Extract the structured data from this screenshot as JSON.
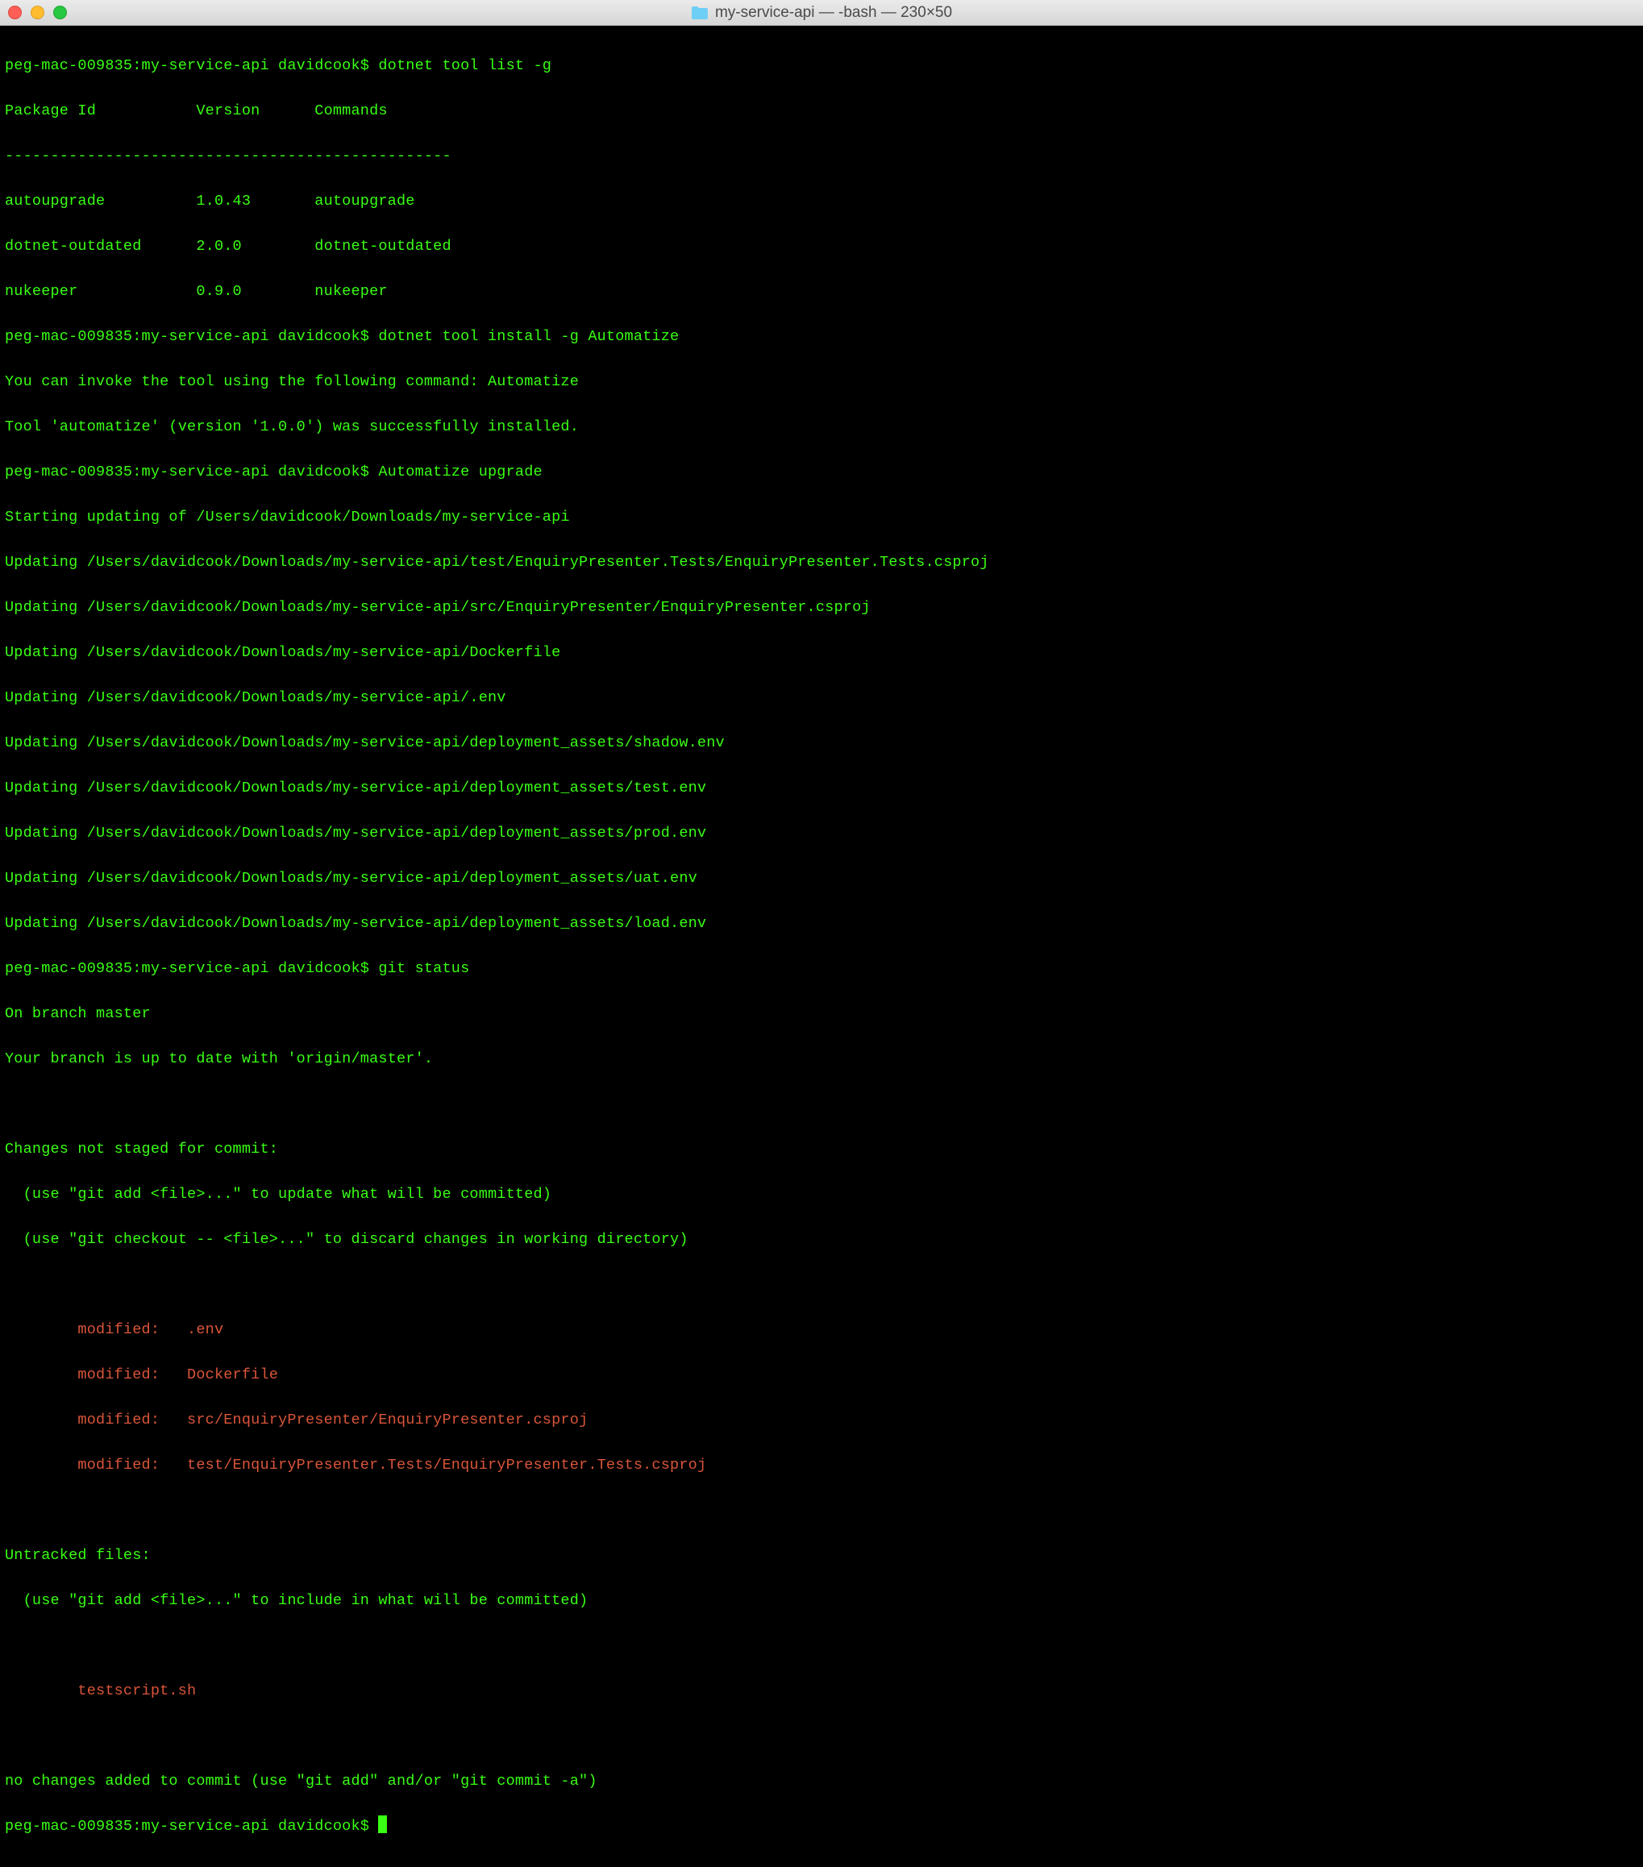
{
  "titlebar": {
    "title": "my-service-api — -bash — 230×50"
  },
  "prompt": "peg-mac-009835:my-service-api davidcook$ ",
  "commands": {
    "c1": "dotnet tool list -g",
    "c2": "dotnet tool install -g Automatize",
    "c3": "Automatize upgrade",
    "c4": "git status"
  },
  "toollist": {
    "header": "Package Id           Version      Commands",
    "divider": "-------------------------------------------------",
    "rows": [
      "autoupgrade          1.0.43       autoupgrade",
      "dotnet-outdated      2.0.0        dotnet-outdated",
      "nukeeper             0.9.0        nukeeper"
    ]
  },
  "install": {
    "l1": "You can invoke the tool using the following command: Automatize",
    "l2": "Tool 'automatize' (version '1.0.0') was successfully installed."
  },
  "upgrade": [
    "Starting updating of /Users/davidcook/Downloads/my-service-api",
    "Updating /Users/davidcook/Downloads/my-service-api/test/EnquiryPresenter.Tests/EnquiryPresenter.Tests.csproj",
    "Updating /Users/davidcook/Downloads/my-service-api/src/EnquiryPresenter/EnquiryPresenter.csproj",
    "Updating /Users/davidcook/Downloads/my-service-api/Dockerfile",
    "Updating /Users/davidcook/Downloads/my-service-api/.env",
    "Updating /Users/davidcook/Downloads/my-service-api/deployment_assets/shadow.env",
    "Updating /Users/davidcook/Downloads/my-service-api/deployment_assets/test.env",
    "Updating /Users/davidcook/Downloads/my-service-api/deployment_assets/prod.env",
    "Updating /Users/davidcook/Downloads/my-service-api/deployment_assets/uat.env",
    "Updating /Users/davidcook/Downloads/my-service-api/deployment_assets/load.env"
  ],
  "git": {
    "branch1": "On branch master",
    "branch2": "Your branch is up to date with 'origin/master'.",
    "blank": "",
    "head_changes": "Changes not staged for commit:",
    "hint_add": "  (use \"git add <file>...\" to update what will be committed)",
    "hint_checkout": "  (use \"git checkout -- <file>...\" to discard changes in working directory)",
    "modified": [
      "        modified:   .env",
      "        modified:   Dockerfile",
      "        modified:   src/EnquiryPresenter/EnquiryPresenter.csproj",
      "        modified:   test/EnquiryPresenter.Tests/EnquiryPresenter.Tests.csproj"
    ],
    "head_untracked": "Untracked files:",
    "hint_untracked": "  (use \"git add <file>...\" to include in what will be committed)",
    "untracked": [
      "        testscript.sh"
    ],
    "summary": "no changes added to commit (use \"git add\" and/or \"git commit -a\")"
  }
}
